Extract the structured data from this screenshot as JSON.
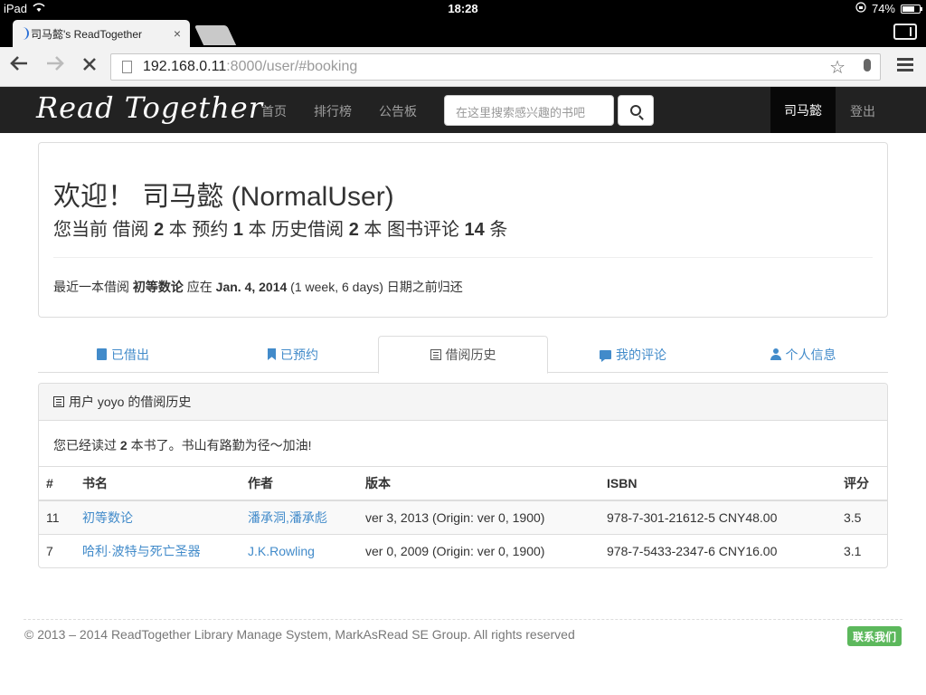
{
  "status_bar": {
    "device": "iPad",
    "time": "18:28",
    "battery": "74%",
    "battery_level": 0.74
  },
  "browser": {
    "tab_title": "司马懿's ReadTogether",
    "tab_close": "×",
    "url_host": "192.168.0.11",
    "url_path": ":8000/user/#booking"
  },
  "navbar": {
    "brand": "Read Together",
    "links": [
      "首页",
      "排行榜",
      "公告板"
    ],
    "search_placeholder": "在这里搜索感兴趣的书吧",
    "user": "司马懿",
    "logout": "登出"
  },
  "welcome": {
    "greeting": "欢迎！ 司马懿 (NormalUser)",
    "stats": {
      "prefix": "您当前 借阅 ",
      "borrowed": "2",
      "t1": " 本 预约 ",
      "reserved": "1",
      "t2": " 本 历史借阅 ",
      "history": "2",
      "t3": " 本 图书评论 ",
      "reviews": "14",
      "t4": " 条"
    },
    "recent": {
      "prefix": "最近一本借阅 ",
      "book": "初等数论",
      "mid": " 应在 ",
      "date": "Jan. 4, 2014",
      "suffix": " (1 week, 6 days) 日期之前归还"
    }
  },
  "tabs": [
    {
      "label": "已借出",
      "icon": "book-icon"
    },
    {
      "label": "已预约",
      "icon": "bookmark-icon"
    },
    {
      "label": "借阅历史",
      "icon": "list-icon"
    },
    {
      "label": "我的评论",
      "icon": "comment-icon"
    },
    {
      "label": "个人信息",
      "icon": "user-icon"
    }
  ],
  "history": {
    "heading": "用户 yoyo 的借阅历史",
    "summary_prefix": "您已经读过 ",
    "summary_count": "2",
    "summary_suffix": " 本书了。书山有路勤为径～加油!",
    "columns": [
      "#",
      "书名",
      "作者",
      "版本",
      "ISBN",
      "评分"
    ],
    "rows": [
      {
        "id": "11",
        "title": "初等数论",
        "author": "潘承洞,潘承彪",
        "edition": "ver 3, 2013 (Origin: ver 0, 1900)",
        "isbn": "978-7-301-21612-5 CNY48.00",
        "rating": "3.5"
      },
      {
        "id": "7",
        "title": "哈利·波特与死亡圣器",
        "author": "J.K.Rowling",
        "edition": "ver 0, 2009 (Origin: ver 0, 1900)",
        "isbn": "978-7-5433-2347-6 CNY16.00",
        "rating": "3.1"
      }
    ]
  },
  "footer": {
    "text": "© 2013 – 2014 ReadTogether Library Manage System, MarkAsRead SE Group. All rights reserved",
    "contact": "联系我们"
  },
  "colors": {
    "link": "#428bca",
    "navbar": "#222222",
    "contact": "#5cb85c"
  }
}
